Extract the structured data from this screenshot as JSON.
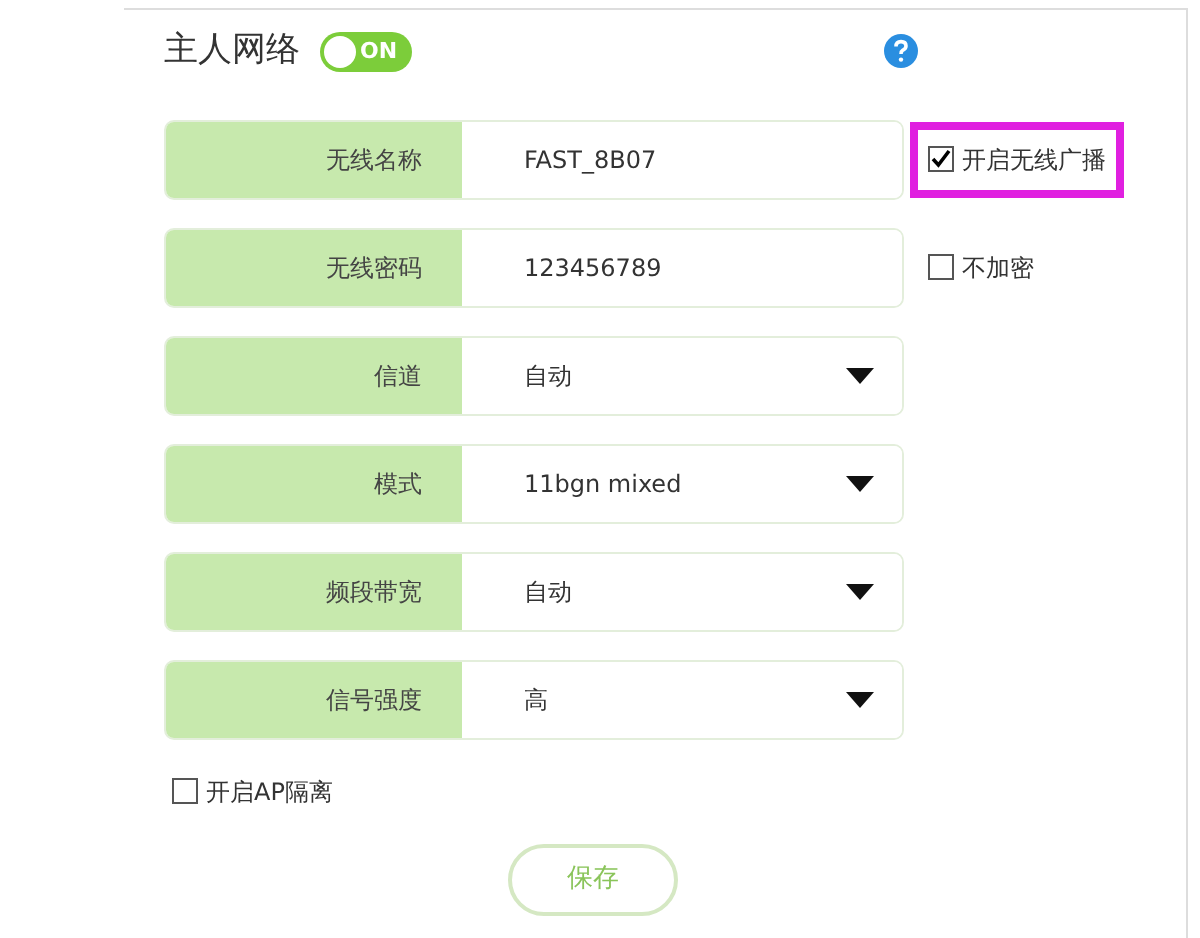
{
  "section": {
    "title": "主人网络",
    "toggle": {
      "on": true,
      "label": "ON"
    }
  },
  "fields": [
    {
      "kind": "text",
      "label": "无线名称",
      "value": "FAST_8B07",
      "option": {
        "label": "开启无线广播",
        "checked": true,
        "highlighted": true
      }
    },
    {
      "kind": "text",
      "label": "无线密码",
      "value": "123456789",
      "option": {
        "label": "不加密",
        "checked": false,
        "highlighted": false
      }
    },
    {
      "kind": "select",
      "label": "信道",
      "value": "自动"
    },
    {
      "kind": "select",
      "label": "模式",
      "value": "11bgn mixed"
    },
    {
      "kind": "select",
      "label": "频段带宽",
      "value": "自动"
    },
    {
      "kind": "select",
      "label": "信号强度",
      "value": "高"
    }
  ],
  "ap_isolation": {
    "label": "开启AP隔离",
    "checked": false
  },
  "save_button": "保存"
}
